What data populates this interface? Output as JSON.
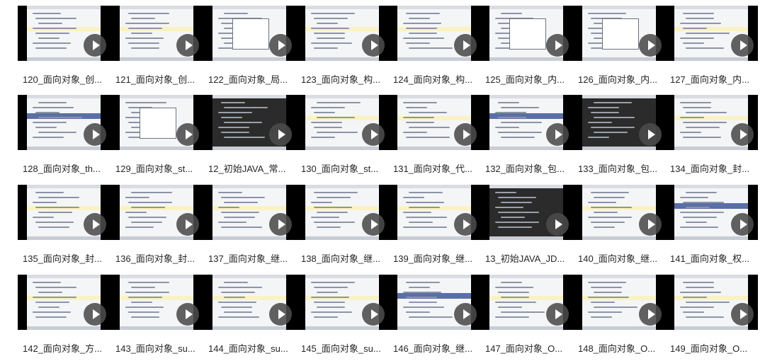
{
  "videos": [
    {
      "title": "120_面向对象_创...",
      "style": "code"
    },
    {
      "title": "121_面向对象_创...",
      "style": "code"
    },
    {
      "title": "122_面向对象_局...",
      "style": "dialog"
    },
    {
      "title": "123_面向对象_构...",
      "style": "code"
    },
    {
      "title": "124_面向对象_构...",
      "style": "code"
    },
    {
      "title": "125_面向对象_内...",
      "style": "dialog"
    },
    {
      "title": "126_面向对象_内...",
      "style": "dialog"
    },
    {
      "title": "127_面向对象_内...",
      "style": "code"
    },
    {
      "title": "128_面向对象_th...",
      "style": "blue"
    },
    {
      "title": "129_面向对象_st...",
      "style": "dialog"
    },
    {
      "title": "12_初始JAVA_常...",
      "style": "dark"
    },
    {
      "title": "130_面向对象_st...",
      "style": "code"
    },
    {
      "title": "131_面向对象_代...",
      "style": "code"
    },
    {
      "title": "132_面向对象_包...",
      "style": "blue"
    },
    {
      "title": "133_面向对象_包...",
      "style": "dark"
    },
    {
      "title": "134_面向对象_封...",
      "style": "code"
    },
    {
      "title": "135_面向对象_封...",
      "style": "code"
    },
    {
      "title": "136_面向对象_封...",
      "style": "code"
    },
    {
      "title": "137_面向对象_继...",
      "style": "code"
    },
    {
      "title": "138_面向对象_继...",
      "style": "code"
    },
    {
      "title": "139_面向对象_继...",
      "style": "code"
    },
    {
      "title": "13_初始JAVA_JD...",
      "style": "dark"
    },
    {
      "title": "140_面向对象_继...",
      "style": "code"
    },
    {
      "title": "141_面向对象_权...",
      "style": "blue"
    },
    {
      "title": "142_面向对象_方...",
      "style": "code"
    },
    {
      "title": "143_面向对象_su...",
      "style": "code"
    },
    {
      "title": "144_面向对象_su...",
      "style": "code"
    },
    {
      "title": "145_面向对象_su...",
      "style": "code"
    },
    {
      "title": "146_面向对象_继...",
      "style": "blue"
    },
    {
      "title": "147_面向对象_O...",
      "style": "code"
    },
    {
      "title": "148_面向对象_O...",
      "style": "code"
    },
    {
      "title": "149_面向对象_O...",
      "style": "code"
    }
  ]
}
